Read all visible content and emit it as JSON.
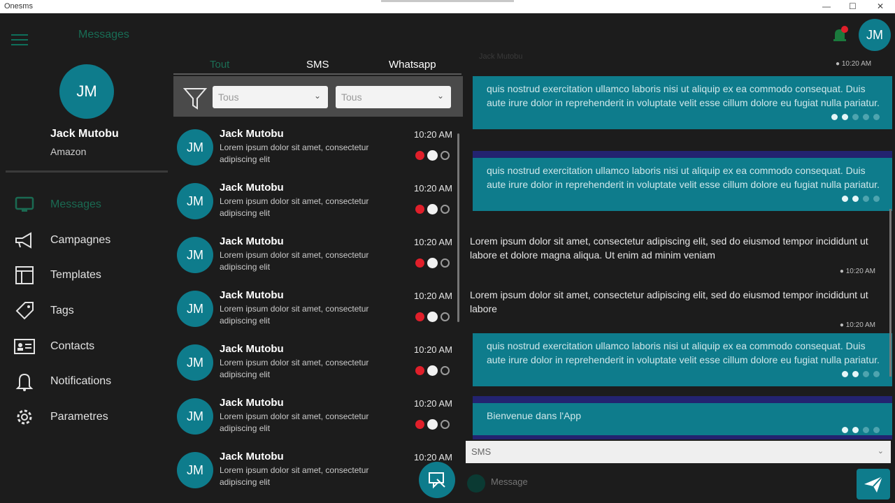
{
  "window": {
    "title": "Onesms",
    "min": "—",
    "max": "☐",
    "close": "✕"
  },
  "header": {
    "app_title": "Messages",
    "avatar_initials": "JM"
  },
  "profile": {
    "initials": "JM",
    "name": "Jack Mutobu",
    "company": "Amazon"
  },
  "nav": [
    {
      "label": "Messages",
      "icon": "monitor-icon"
    },
    {
      "label": "Campagnes",
      "icon": "megaphone-icon"
    },
    {
      "label": "Templates",
      "icon": "template-icon"
    },
    {
      "label": "Tags",
      "icon": "tag-icon"
    },
    {
      "label": "Contacts",
      "icon": "contact-card-icon"
    },
    {
      "label": "Notifications",
      "icon": "bell-icon"
    },
    {
      "label": "Parametres",
      "icon": "gear-icon"
    }
  ],
  "tabs": [
    {
      "label": "Tout",
      "active": true
    },
    {
      "label": "SMS",
      "active": false
    },
    {
      "label": "Whatsapp",
      "active": false
    }
  ],
  "filters": {
    "first": "Tous",
    "second": "Tous"
  },
  "conversations": [
    {
      "initials": "JM",
      "name": "Jack Mutobu",
      "preview": "Lorem ipsum dolor sit amet, consectetur adipiscing elit",
      "time": "10:20 AM"
    },
    {
      "initials": "JM",
      "name": "Jack Mutobu",
      "preview": "Lorem ipsum dolor sit amet, consectetur adipiscing elit",
      "time": "10:20 AM"
    },
    {
      "initials": "JM",
      "name": "Jack Mutobu",
      "preview": "Lorem ipsum dolor sit amet, consectetur adipiscing elit",
      "time": "10:20 AM"
    },
    {
      "initials": "JM",
      "name": "Jack Mutobu",
      "preview": "Lorem ipsum dolor sit amet, consectetur adipiscing elit",
      "time": "10:20 AM"
    },
    {
      "initials": "JM",
      "name": "Jack Mutobu",
      "preview": "Lorem ipsum dolor sit amet, consectetur adipiscing elit",
      "time": "10:20 AM"
    },
    {
      "initials": "JM",
      "name": "Jack Mutobu",
      "preview": "Lorem ipsum dolor sit amet, consectetur adipiscing elit",
      "time": "10:20 AM"
    },
    {
      "initials": "JM",
      "name": "Jack Mutobu",
      "preview": "Lorem ipsum dolor sit amet, consectetur adipiscing elit",
      "time": "10:20 AM"
    }
  ],
  "chat": {
    "header_text": "Jack Mutobu",
    "top_time": "10:20 AM",
    "out1": "quis nostrud exercitation ullamco laboris nisi ut aliquip ex ea commodo consequat. Duis aute irure dolor in reprehenderit in voluptate velit esse cillum dolore eu fugiat nulla pariatur.",
    "out2": "quis nostrud exercitation ullamco laboris nisi ut aliquip ex ea commodo consequat. Duis aute irure dolor in reprehenderit in voluptate velit esse cillum dolore eu fugiat nulla pariatur.",
    "in1": "Lorem ipsum dolor sit amet, consectetur adipiscing elit, sed do eiusmod tempor incididunt ut labore et dolore magna aliqua. Ut enim ad minim veniam",
    "in1_time": "10:20 AM",
    "in2": "Lorem ipsum dolor sit amet, consectetur adipiscing elit, sed do eiusmod tempor incididunt ut labore",
    "in2_time": "10:20 AM",
    "out3": "quis nostrud exercitation ullamco laboris nisi ut aliquip ex ea commodo consequat. Duis aute irure dolor in reprehenderit in voluptate velit esse cillum dolore eu fugiat nulla pariatur.",
    "out4": "Bienvenue dans l'App"
  },
  "composer": {
    "type_select": "SMS",
    "placeholder": "Message"
  },
  "colors": {
    "accent": "#0e7c8c",
    "active_green": "#1a6a52",
    "badge_red": "#e01f2a",
    "background": "#1c1c1c"
  }
}
